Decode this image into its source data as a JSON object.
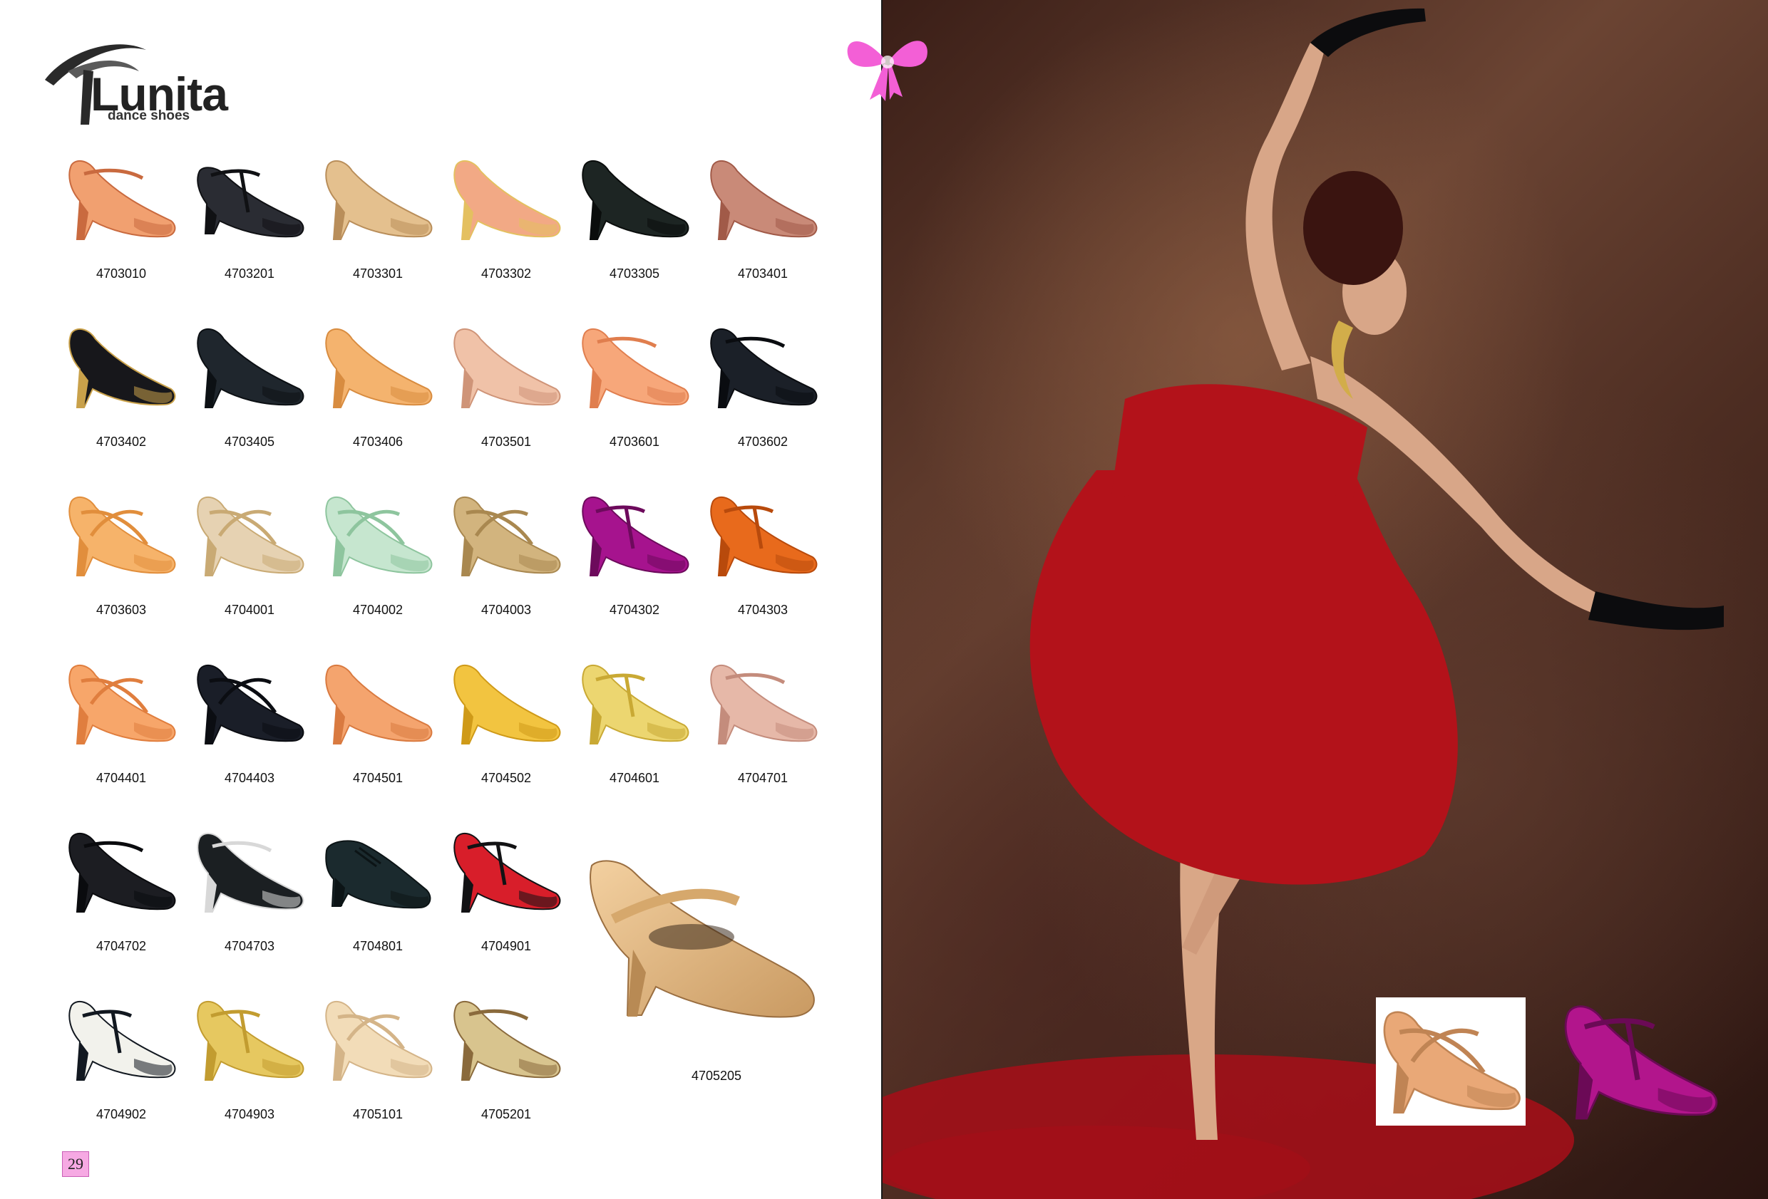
{
  "brand": {
    "name": "Lunita",
    "tagline": "dance shoes"
  },
  "page_number": "29",
  "products": [
    {
      "code": "4703010",
      "colors": [
        "#f1a070",
        "#c96a3f"
      ],
      "style": "strap"
    },
    {
      "code": "4703201",
      "colors": [
        "#2a2c33",
        "#101114"
      ],
      "style": "tstrap-low"
    },
    {
      "code": "4703301",
      "colors": [
        "#e4c08e",
        "#b98e5a"
      ],
      "style": "pump"
    },
    {
      "code": "4703302",
      "colors": [
        "#f2a985",
        "#e4c060"
      ],
      "style": "pump"
    },
    {
      "code": "4703305",
      "colors": [
        "#1d2523",
        "#0a0d0c"
      ],
      "style": "pump"
    },
    {
      "code": "4703401",
      "colors": [
        "#c98a78",
        "#a15a48"
      ],
      "style": "pump"
    },
    {
      "code": "4703402",
      "colors": [
        "#17171b",
        "#c9a14a"
      ],
      "style": "pump"
    },
    {
      "code": "4703405",
      "colors": [
        "#1f262d",
        "#0c1014"
      ],
      "style": "pump"
    },
    {
      "code": "4703406",
      "colors": [
        "#f4b36e",
        "#d88c40"
      ],
      "style": "pump"
    },
    {
      "code": "4703501",
      "colors": [
        "#f0c2a8",
        "#cf9478"
      ],
      "style": "pump"
    },
    {
      "code": "4703601",
      "colors": [
        "#f7a77a",
        "#e07e4e"
      ],
      "style": "strap"
    },
    {
      "code": "4703602",
      "colors": [
        "#1b2028",
        "#0a0c10"
      ],
      "style": "strap"
    },
    {
      "code": "4703603",
      "colors": [
        "#f6b36a",
        "#e18e3c"
      ],
      "style": "cross"
    },
    {
      "code": "4704001",
      "colors": [
        "#e6d2b2",
        "#c9aa74"
      ],
      "style": "cross"
    },
    {
      "code": "4704002",
      "colors": [
        "#c6e6cf",
        "#8ec59e"
      ],
      "style": "cross"
    },
    {
      "code": "4704003",
      "colors": [
        "#d2b47e",
        "#a98850"
      ],
      "style": "cross"
    },
    {
      "code": "4704302",
      "colors": [
        "#a6138e",
        "#6d0a5c"
      ],
      "style": "tstrap"
    },
    {
      "code": "4704303",
      "colors": [
        "#e86a1c",
        "#b84a0c"
      ],
      "style": "tstrap"
    },
    {
      "code": "4704401",
      "colors": [
        "#f7a66a",
        "#e07e3e"
      ],
      "style": "cross"
    },
    {
      "code": "4704403",
      "colors": [
        "#1a1e28",
        "#0b0d12"
      ],
      "style": "cross"
    },
    {
      "code": "4704501",
      "colors": [
        "#f4a46e",
        "#d97a40"
      ],
      "style": "pump"
    },
    {
      "code": "4704502",
      "colors": [
        "#f2c440",
        "#cf9a18"
      ],
      "style": "pump"
    },
    {
      "code": "4704601",
      "colors": [
        "#ecd670",
        "#c9a934"
      ],
      "style": "tstrap"
    },
    {
      "code": "4704701",
      "colors": [
        "#e6b8a8",
        "#c48c7c"
      ],
      "style": "strap"
    },
    {
      "code": "4704702",
      "colors": [
        "#1c1d22",
        "#0a0b0e"
      ],
      "style": "strap"
    },
    {
      "code": "4704703",
      "colors": [
        "#1b1f22",
        "#d8d8d8"
      ],
      "style": "strap"
    },
    {
      "code": "4704801",
      "colors": [
        "#1b2a2e",
        "#0c1416"
      ],
      "style": "oxford"
    },
    {
      "code": "4704901",
      "colors": [
        "#d81e2a",
        "#121214"
      ],
      "style": "tstrap"
    },
    {
      "code": "4704902",
      "colors": [
        "#f2f2ec",
        "#121820"
      ],
      "style": "tstrap"
    },
    {
      "code": "4704903",
      "colors": [
        "#e6c860",
        "#c29c30"
      ],
      "style": "tstrap"
    },
    {
      "code": "4705101",
      "colors": [
        "#f2dcb8",
        "#d4b488"
      ],
      "style": "cross"
    },
    {
      "code": "4705201",
      "colors": [
        "#d8c48e",
        "#8a6a3c"
      ],
      "style": "strap"
    }
  ],
  "featured": {
    "code": "4705205",
    "colors": [
      "#f3d0a0",
      "#c99a62"
    ]
  },
  "photo": {
    "dress_color": "#b3121a",
    "glove_color": "#0c0c0e",
    "petal_color": "#a20f18",
    "ribbon_color": "#f35fd6"
  },
  "insets": [
    {
      "colors": [
        "#e9a877",
        "#c08454"
      ]
    },
    {
      "colors": [
        "#b2158c",
        "#6b0a56"
      ]
    }
  ]
}
